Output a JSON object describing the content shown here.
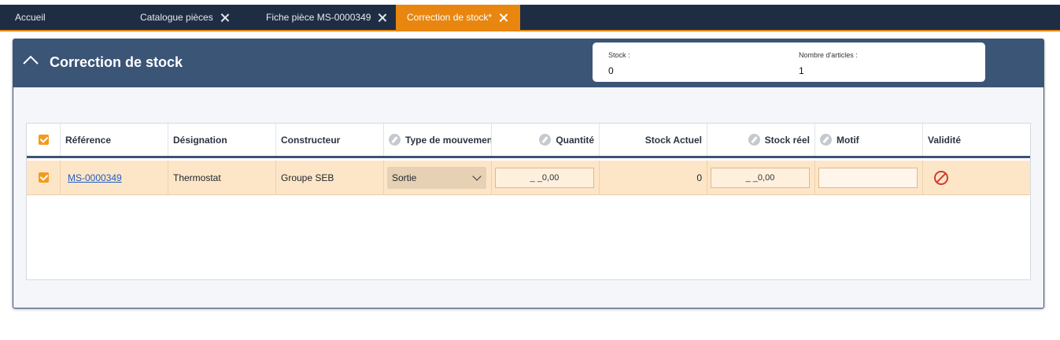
{
  "tabs": [
    {
      "label": "Accueil",
      "closable": false,
      "active": false
    },
    {
      "label": "Catalogue pièces",
      "closable": true,
      "active": false
    },
    {
      "label": "Fiche pièce MS-0000349",
      "closable": true,
      "active": false
    },
    {
      "label": "Correction de stock*",
      "closable": true,
      "active": true
    }
  ],
  "panel": {
    "title": "Correction de stock",
    "info": {
      "stock_label": "Stock :",
      "stock_value": "0",
      "articles_label": "Nombre d'articles :",
      "articles_value": "1"
    }
  },
  "table": {
    "columns": {
      "reference": "Référence",
      "designation": "Désignation",
      "constructeur": "Constructeur",
      "type_mouvement": "Type de mouvement",
      "quantite": "Quantité",
      "stock_actuel": "Stock Actuel",
      "stock_reel": "Stock réel",
      "motif": "Motif",
      "validite": "Validité"
    },
    "rows": [
      {
        "reference": "MS-0000349",
        "designation": "Thermostat",
        "constructeur": "Groupe SEB",
        "type_mouvement": "Sortie",
        "quantite": "_ _0,00",
        "stock_actuel": "0",
        "stock_reel": "_ _0,00",
        "motif": ""
      }
    ]
  },
  "colors": {
    "tabbar": "#1f2d44",
    "accent": "#e8860f",
    "panel_header": "#3b5577",
    "row_selected": "#fde6c8",
    "invalid": "#d23a2f"
  },
  "icons": {
    "collapse": "chevron-up-icon",
    "close_tab": "close-icon",
    "editable_column": "pencil-icon",
    "validity": "forbidden-icon"
  }
}
